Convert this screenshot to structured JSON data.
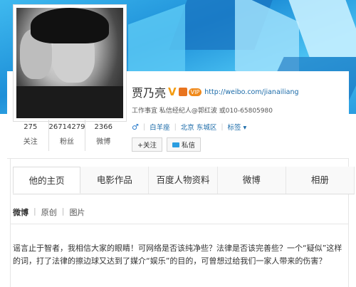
{
  "profile": {
    "name": "贾乃亮",
    "verified_mark": "V",
    "vip_label": "VIP",
    "url": "http://weibo.com/jianailiang",
    "agency_line": "工作事宜    私信经纪人@郭红波   或010-65805980",
    "gender_icon": "male-icon",
    "zodiac": "白羊座",
    "location": "北京 东城区",
    "tags_label": "标签 ▾",
    "follow_button": "+关注",
    "message_button": "私信"
  },
  "stats": [
    {
      "value": "275",
      "label": "关注"
    },
    {
      "value": "26714279",
      "label": "粉丝"
    },
    {
      "value": "2366",
      "label": "微博"
    }
  ],
  "tabs": [
    {
      "label": "他的主页",
      "active": true
    },
    {
      "label": "电影作品",
      "active": false
    },
    {
      "label": "百度人物资料",
      "active": false
    },
    {
      "label": "微博",
      "active": false
    },
    {
      "label": "相册",
      "active": false
    }
  ],
  "subtabs": [
    {
      "label": "微博",
      "active": true
    },
    {
      "label": "原创",
      "active": false
    },
    {
      "label": "图片",
      "active": false
    }
  ],
  "subtab_separator": "|",
  "post": {
    "text": "谣言止于智者，我相信大家的眼睛！可网络是否该纯净些？法律是否该完善些？一个“疑似”这样的词，打了法律的擦边球又达到了媒介“娱乐”的目的，可曾想过给我们一家人带来的伤害？"
  },
  "colors": {
    "link": "#1a6aa8",
    "vip": "#f08a1c",
    "banner": "#1d8fd8"
  }
}
